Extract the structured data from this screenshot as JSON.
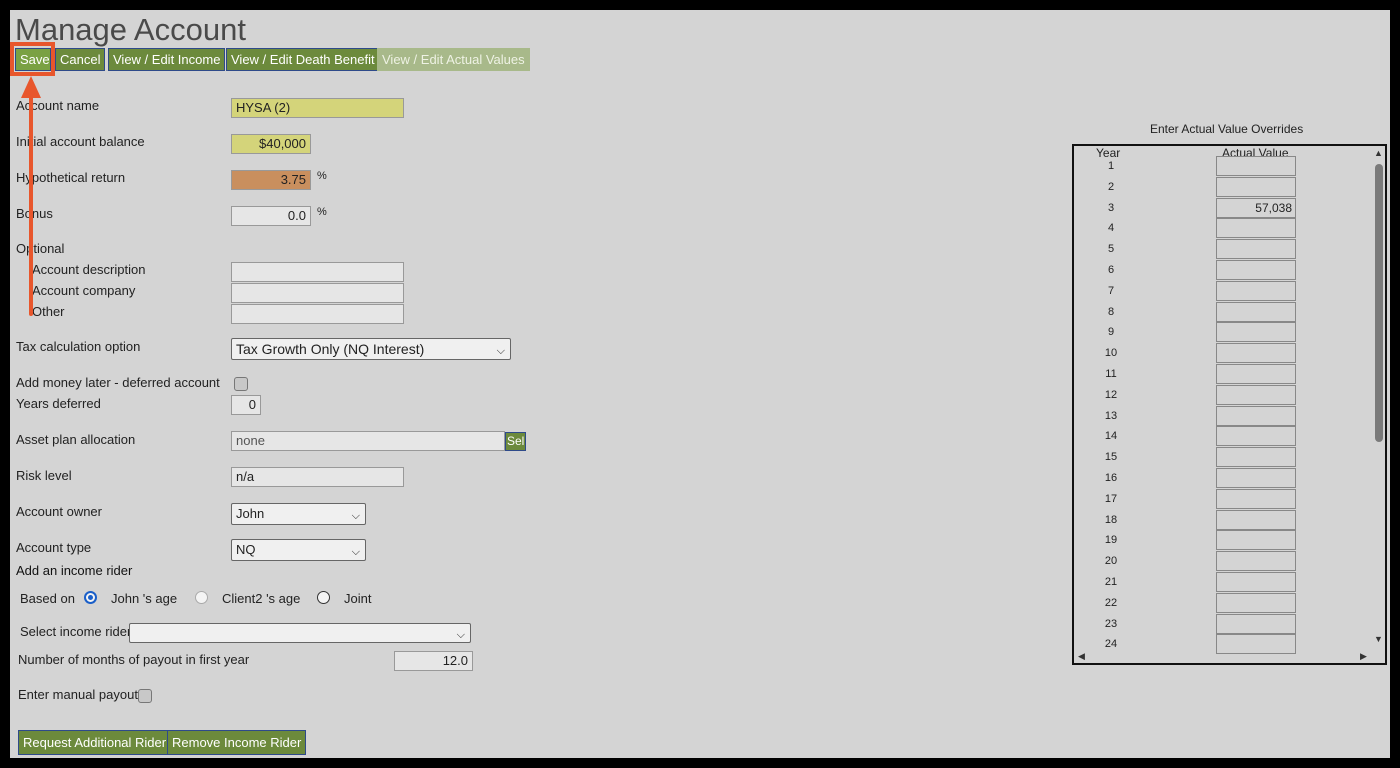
{
  "page": {
    "title": "Manage Account"
  },
  "toolbar": {
    "save": "Save",
    "cancel": "Cancel",
    "income": "View / Edit Income",
    "death_benefit": "View / Edit Death Benefit",
    "actual_values": "View / Edit Actual Values"
  },
  "form": {
    "account_name_label": "Account name",
    "account_name_value": "HYSA (2)",
    "initial_balance_label": "Initial account balance",
    "initial_balance_value": "$40,000",
    "return_label": "Hypothetical return",
    "return_value": "3.75",
    "return_unit": "%",
    "bonus_label": "Bonus",
    "bonus_value": "0.0",
    "bonus_unit": "%",
    "optional_label": "Optional",
    "description_label": "Account description",
    "company_label": "Account company",
    "other_label": "Other",
    "tax_label": "Tax calculation option",
    "tax_value": "Tax Growth Only (NQ Interest)",
    "deferred_label": "Add money later - deferred account",
    "years_deferred_label": "Years deferred",
    "years_deferred_value": "0",
    "asset_label": "Asset plan allocation",
    "asset_value": "none",
    "asset_select_button": "Sel",
    "risk_label": "Risk level",
    "risk_value": "n/a",
    "owner_label": "Account owner",
    "owner_value": "John",
    "type_label": "Account type",
    "type_value": "NQ",
    "rider_heading": "Add an income rider",
    "based_on_label": "Based on",
    "based_on_options": [
      "John 's age",
      "Client2 's age",
      "Joint"
    ],
    "select_rider_label": "Select income rider",
    "select_rider_value": "",
    "months_label": "Number of months of payout in first year",
    "months_value": "12.0",
    "manual_payout_label": "Enter manual payout"
  },
  "bottom_buttons": {
    "request": "Request Additional Rider",
    "remove": "Remove Income Rider"
  },
  "overrides": {
    "title": "Enter Actual Value Overrides",
    "year_header": "Year",
    "value_header": "Actual Value",
    "rows": [
      {
        "year": "1",
        "value": ""
      },
      {
        "year": "2",
        "value": ""
      },
      {
        "year": "3",
        "value": "57,038"
      },
      {
        "year": "4",
        "value": ""
      },
      {
        "year": "5",
        "value": ""
      },
      {
        "year": "6",
        "value": ""
      },
      {
        "year": "7",
        "value": ""
      },
      {
        "year": "8",
        "value": ""
      },
      {
        "year": "9",
        "value": ""
      },
      {
        "year": "10",
        "value": ""
      },
      {
        "year": "11",
        "value": ""
      },
      {
        "year": "12",
        "value": ""
      },
      {
        "year": "13",
        "value": ""
      },
      {
        "year": "14",
        "value": ""
      },
      {
        "year": "15",
        "value": ""
      },
      {
        "year": "16",
        "value": ""
      },
      {
        "year": "17",
        "value": ""
      },
      {
        "year": "18",
        "value": ""
      },
      {
        "year": "19",
        "value": ""
      },
      {
        "year": "20",
        "value": ""
      },
      {
        "year": "21",
        "value": ""
      },
      {
        "year": "22",
        "value": ""
      },
      {
        "year": "23",
        "value": ""
      },
      {
        "year": "24",
        "value": ""
      }
    ]
  },
  "colors": {
    "accent_button": "#6c8a3c",
    "highlight": "#e8562c",
    "field_yellow": "#d4d47a",
    "field_orange": "#c98f5e"
  }
}
